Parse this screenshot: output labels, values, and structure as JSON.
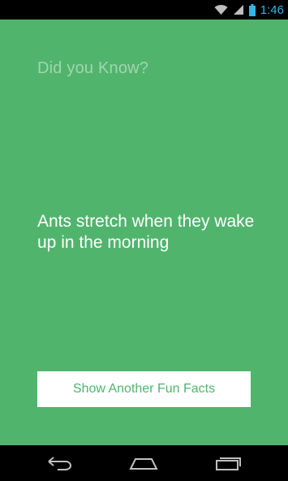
{
  "status_bar": {
    "time": "1:46",
    "icons": [
      "wifi-icon",
      "signal-icon",
      "battery-icon"
    ],
    "time_color": "#33b5e5"
  },
  "app": {
    "background_color": "#51b46d",
    "heading": "Did you Know?",
    "fact": "Ants stretch when they wake up in the morning",
    "button_label": "Show Another Fun Facts"
  },
  "nav_bar": {
    "buttons": [
      "back-icon",
      "home-icon",
      "recent-apps-icon"
    ]
  }
}
